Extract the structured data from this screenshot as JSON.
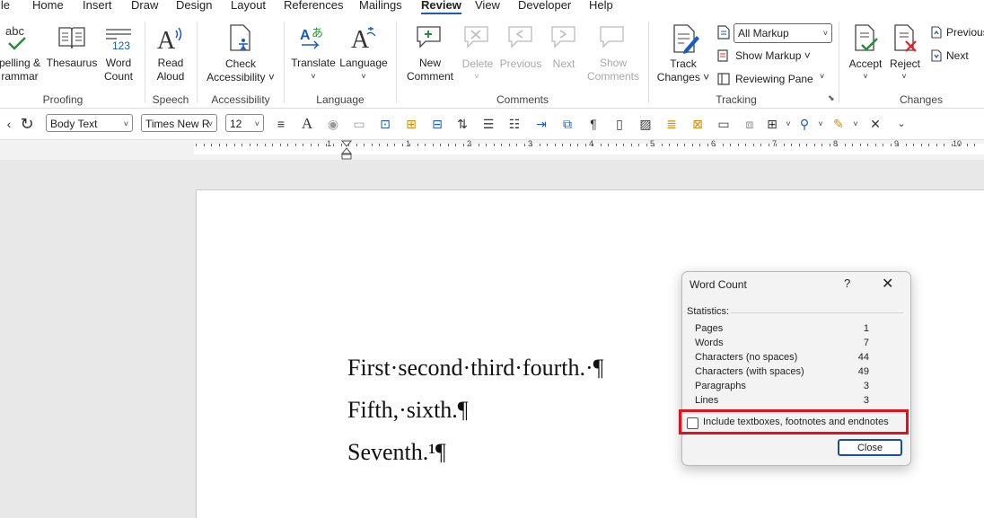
{
  "menu": [
    "ile",
    "Home",
    "Insert",
    "Draw",
    "Design",
    "Layout",
    "References",
    "Mailings",
    "Review",
    "View",
    "Developer",
    "Help"
  ],
  "ribbon": {
    "spelling": [
      "pelling &",
      "rammar"
    ],
    "thesaurus": "Thesaurus",
    "word_count": [
      "Word",
      "Count"
    ],
    "read_aloud": [
      "Read",
      "Aloud"
    ],
    "check_accessibility": [
      "Check",
      "Accessibility ˅"
    ],
    "translate": "Translate",
    "language": "Language",
    "new_comment": [
      "New",
      "Comment"
    ],
    "delete": "Delete",
    "previous": "Previous",
    "next": "Next",
    "show_comments": [
      "Show",
      "Comments"
    ],
    "track_changes": [
      "Track",
      "Changes ˅"
    ],
    "markup_select": "All Markup",
    "show_markup": "Show Markup ˅",
    "reviewing_pane": "Reviewing Pane",
    "accept": "Accept",
    "reject": "Reject",
    "previous_change": "Previous",
    "next_change": "Next",
    "groups": {
      "proofing": "Proofing",
      "speech": "Speech",
      "accessibility": "Accessibility",
      "language": "Language",
      "comments": "Comments",
      "tracking": "Tracking",
      "changes": "Changes"
    }
  },
  "format_bar": {
    "style": "Body Text",
    "font": "Times New R",
    "size": "12"
  },
  "ruler": [
    "1",
    "1",
    "2",
    "3",
    "4",
    "5",
    "6",
    "7",
    "8",
    "9",
    "10"
  ],
  "document": {
    "lines": [
      "First·second·third·fourth.·¶",
      "Fifth,·sixth.¶",
      "Seventh.¹¶"
    ]
  },
  "dialog": {
    "title": "Word Count",
    "help": "?",
    "close_x": "✕",
    "statistics_label": "Statistics:",
    "stats": [
      {
        "label": "Pages",
        "value": "1"
      },
      {
        "label": "Words",
        "value": "7"
      },
      {
        "label": "Characters (no spaces)",
        "value": "44"
      },
      {
        "label": "Characters (with spaces)",
        "value": "49"
      },
      {
        "label": "Paragraphs",
        "value": "3"
      },
      {
        "label": "Lines",
        "value": "3"
      }
    ],
    "include_label": "Include textboxes, footnotes and endnotes",
    "include_checked": false,
    "close_button": "Close"
  },
  "colors": {
    "accent": "#185abd",
    "highlight": "#e0121e"
  }
}
